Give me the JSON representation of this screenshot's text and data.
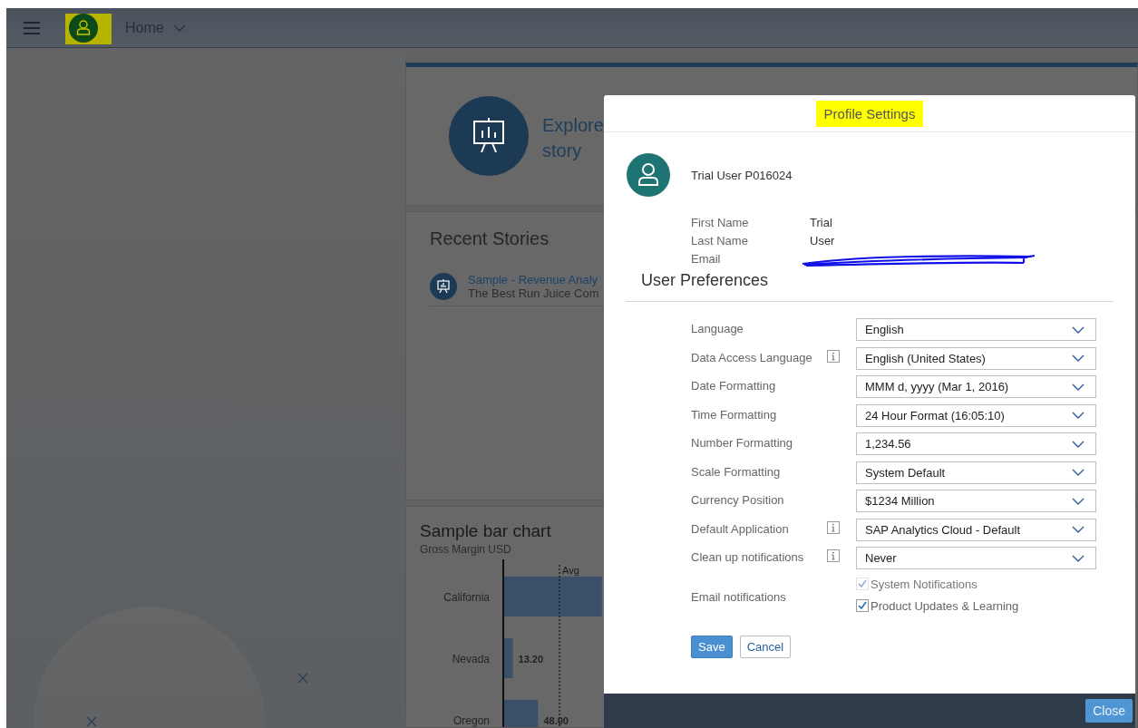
{
  "header": {
    "home_label": "Home"
  },
  "explore_card": {
    "title_lines": [
      "Explore",
      "story"
    ]
  },
  "recent_stories": {
    "title": "Recent Stories",
    "items": [
      {
        "title": "Sample - Revenue Analy",
        "subtitle": "The Best Run Juice Com"
      }
    ]
  },
  "bar_chart_card": {
    "title": "Sample bar chart",
    "subtitle": "Gross Margin USD",
    "chart_data": {
      "type": "bar",
      "orientation": "horizontal",
      "categories": [
        "California",
        "Nevada",
        "Oregon"
      ],
      "values": [
        136,
        13.2,
        48
      ],
      "value_labels": [
        null,
        "13.20",
        "48.00"
      ]
    },
    "average_marker": {
      "label": "Avg"
    }
  },
  "dialog": {
    "title": "Profile Settings",
    "user_name": "Trial User P016024",
    "fields": [
      {
        "label": "First Name",
        "value": "Trial"
      },
      {
        "label": "Last Name",
        "value": "User"
      },
      {
        "label": "Email",
        "redacted": true
      }
    ],
    "section_title": "User Preferences",
    "preferences": [
      {
        "label": "Language",
        "info": false,
        "value": "English"
      },
      {
        "label": "Data Access Language",
        "info": true,
        "value": "English (United States)"
      },
      {
        "label": "Date Formatting",
        "info": false,
        "value": "MMM d, yyyy (Mar 1, 2016)"
      },
      {
        "label": "Time Formatting",
        "info": false,
        "value": "24 Hour Format (16:05:10)"
      },
      {
        "label": "Number Formatting",
        "info": false,
        "value": "1,234.56"
      },
      {
        "label": "Scale Formatting",
        "info": false,
        "value": "System Default"
      },
      {
        "label": "Currency Position",
        "info": false,
        "value": "$1234 Million"
      },
      {
        "label": "Default Application",
        "info": true,
        "value": "SAP Analytics Cloud - Default"
      },
      {
        "label": "Clean up notifications",
        "info": true,
        "value": "Never"
      }
    ],
    "email_notifications": {
      "label": "Email notifications",
      "options": [
        {
          "label": "System Notifications",
          "checked": true,
          "disabled": true
        },
        {
          "label": "Product Updates & Learning",
          "checked": true,
          "disabled": false
        }
      ]
    },
    "buttons": [
      {
        "label": "Save",
        "kind": "primary"
      },
      {
        "label": "Cancel",
        "kind": "secondary"
      }
    ],
    "close_button": "Close"
  }
}
